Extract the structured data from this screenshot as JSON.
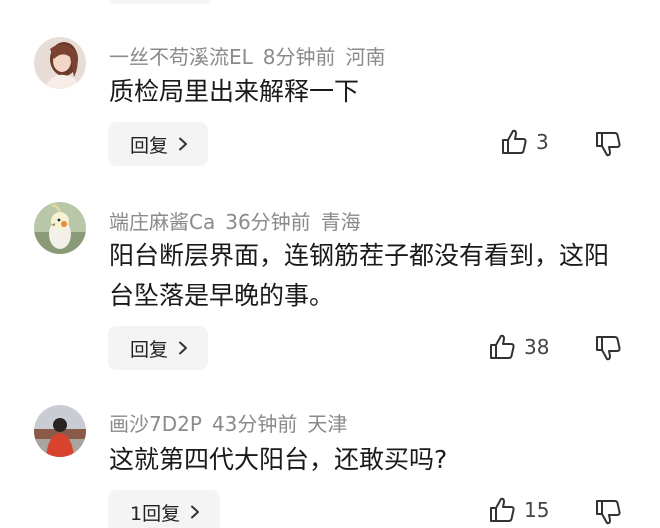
{
  "comments": [
    {
      "username": "一丝不苟溪流EL",
      "time": "8分钟前",
      "location": "河南",
      "text": "质检局里出来解释一下",
      "reply_label": "回复",
      "likes": "3",
      "avatar_icon": "avatar-woman-photo"
    },
    {
      "username": "端庄麻酱Ca",
      "time": "36分钟前",
      "location": "青海",
      "text": "阳台断层界面，连钢筋茬子都没有看到，这阳台坠落是早晚的事。",
      "reply_label": "回复",
      "likes": "38",
      "avatar_icon": "avatar-cockatiel-bird"
    },
    {
      "username": "画沙7D2P",
      "time": "43分钟前",
      "location": "天津",
      "text": "这就第四代大阳台，还敢买吗?",
      "reply_label": "1回复",
      "likes": "15",
      "avatar_icon": "avatar-person-red-jacket"
    }
  ],
  "colors": {
    "meta_text": "#8a8a8a",
    "body_text": "#1a1a1a",
    "reply_bg": "#f4f4f4"
  }
}
